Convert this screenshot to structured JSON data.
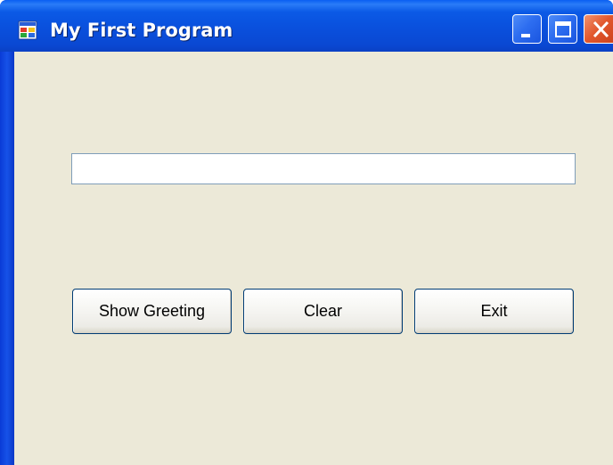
{
  "window": {
    "title": "My First Program",
    "controls": {
      "minimize_icon": "minimize-icon",
      "maximize_icon": "maximize-icon",
      "close_icon": "close-icon"
    },
    "title_bar_color": "#0a4fdc",
    "client_color": "#ece9d8"
  },
  "form": {
    "textbox": {
      "value": "",
      "placeholder": ""
    },
    "buttons": {
      "show_greeting": "Show Greeting",
      "clear": "Clear",
      "exit": "Exit"
    }
  }
}
